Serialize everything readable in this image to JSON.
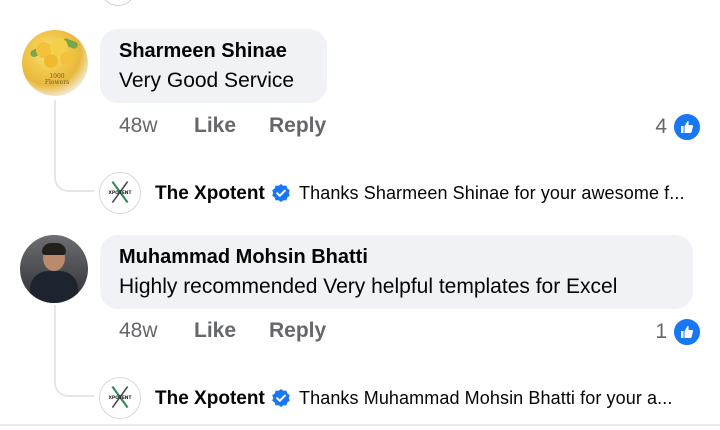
{
  "comments": [
    {
      "author": "Sharmeen Shinae",
      "text": "Very Good Service",
      "time": "48w",
      "like_label": "Like",
      "reply_label": "Reply",
      "reaction_count": "4",
      "avatar_caption": "1000 Flowers"
    },
    {
      "author": "Muhammad Mohsin Bhatti",
      "text": "Highly recommended Very helpful templates for Excel",
      "time": "48w",
      "like_label": "Like",
      "reply_label": "Reply",
      "reaction_count": "1"
    }
  ],
  "replies": [
    {
      "author": "The Xpotent",
      "text": "Thanks Sharmeen Shinae for your awesome f...",
      "avatar_label": "XPOTENT"
    },
    {
      "author": "The Xpotent",
      "text": "Thanks Muhammad Mohsin Bhatti for your a...",
      "avatar_label": "XPOTENT"
    }
  ],
  "colors": {
    "like_blue": "#1877f2",
    "meta_gray": "#65676b",
    "bubble": "#f0f2f5"
  }
}
